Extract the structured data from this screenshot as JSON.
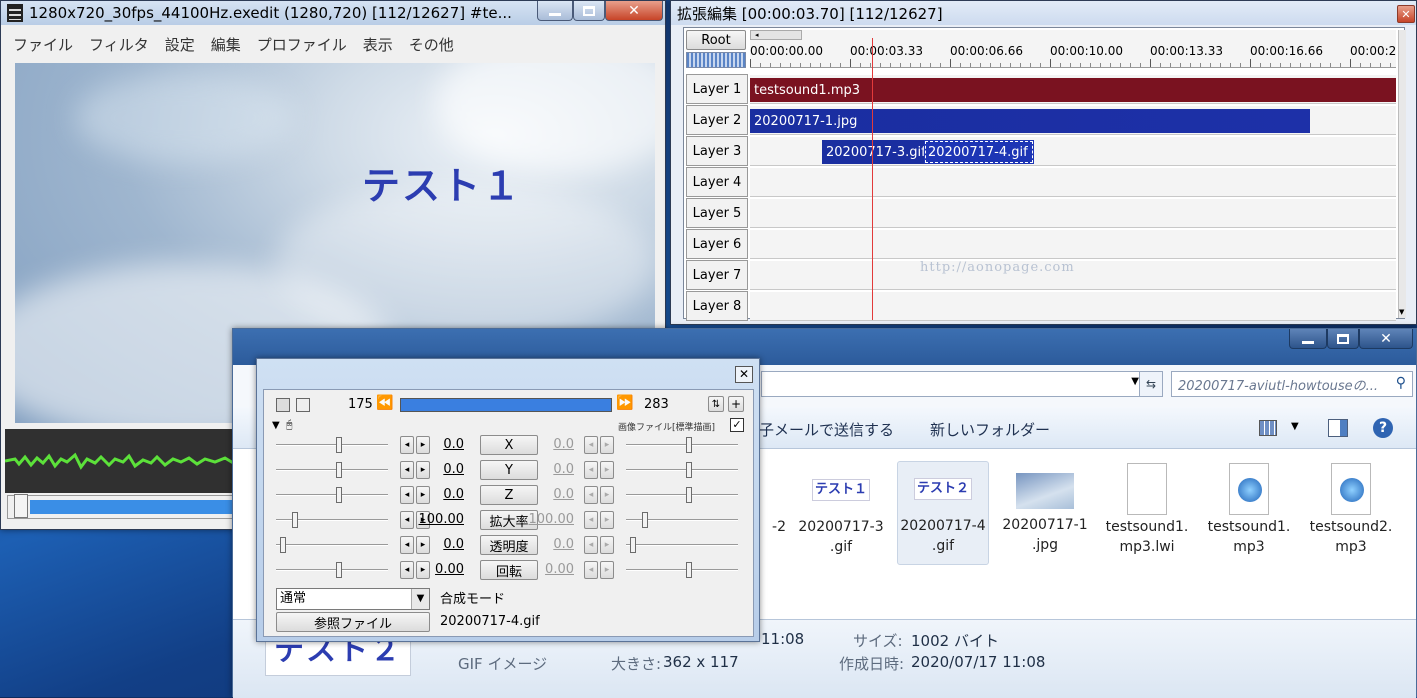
{
  "main_window": {
    "title": "1280x720_30fps_44100Hz.exedit (1280,720)  [112/12627]  #te...",
    "menu": [
      "ファイル",
      "フィルタ",
      "設定",
      "編集",
      "プロファイル",
      "表示",
      "その他"
    ],
    "preview_text": "テスト１"
  },
  "timeline": {
    "title": "拡張編集 [00:00:03.70] [112/12627]",
    "root_label": "Root",
    "ticks": [
      "00:00:00.00",
      "00:00:03.33",
      "00:00:06.66",
      "00:00:10.00",
      "00:00:13.33",
      "00:00:16.66",
      "00:00:2"
    ],
    "layers": [
      "Layer 1",
      "Layer 2",
      "Layer 3",
      "Layer 4",
      "Layer 5",
      "Layer 6",
      "Layer 7",
      "Layer 8"
    ],
    "clips": [
      {
        "label": "testsound1.mp3",
        "color": "#7a1220"
      },
      {
        "label": "20200717-1.jpg",
        "color": "#1a2ea0"
      },
      {
        "label": "20200717-3.gif",
        "color": "#1a2ea0"
      },
      {
        "label": "20200717-4.gif",
        "color": "#1a2ea0"
      }
    ],
    "watermark": "http://aonopage.com"
  },
  "explorer": {
    "search_placeholder": "20200717-aviutl-howtouseの...",
    "command_email": "子メールで送信する",
    "command_new_folder": "新しいフォルダー",
    "files": [
      {
        "line1": "-2",
        "line2": ""
      },
      {
        "line1": "20200717-3",
        "line2": ".gif",
        "thumb": "テスト１"
      },
      {
        "line1": "20200717-4",
        "line2": ".gif",
        "thumb": "テスト２"
      },
      {
        "line1": "20200717-1",
        "line2": ".jpg"
      },
      {
        "line1": "testsound1.",
        "line2": "mp3.lwi"
      },
      {
        "line1": "testsound1.",
        "line2": "mp3"
      },
      {
        "line1": "testsound2.",
        "line2": "mp3"
      }
    ],
    "details": {
      "preview_text": "テスト２",
      "type": "GIF イメージ",
      "dims_label": "大きさ:",
      "dims_value": "362 x 117",
      "time_partial": "11:08",
      "size_label": "サイズ:",
      "size_value": "1002 バイト",
      "created_label": "作成日時:",
      "created_value": "2020/07/17 11:08"
    }
  },
  "dialog": {
    "frame_start": "175",
    "frame_end": "283",
    "section_label": "画像ファイル[標準描画]",
    "params": [
      {
        "name": "X",
        "left": "0.0",
        "right": "0.0"
      },
      {
        "name": "Y",
        "left": "0.0",
        "right": "0.0"
      },
      {
        "name": "Z",
        "left": "0.0",
        "right": "0.0"
      },
      {
        "name": "拡大率",
        "left": "100.00",
        "right": "100.00"
      },
      {
        "name": "透明度",
        "left": "0.0",
        "right": "0.0"
      },
      {
        "name": "回転",
        "left": "0.00",
        "right": "0.00"
      }
    ],
    "blend_value": "通常",
    "blend_label": "合成モード",
    "ref_button": "参照ファイル",
    "filename": "20200717-4.gif"
  }
}
